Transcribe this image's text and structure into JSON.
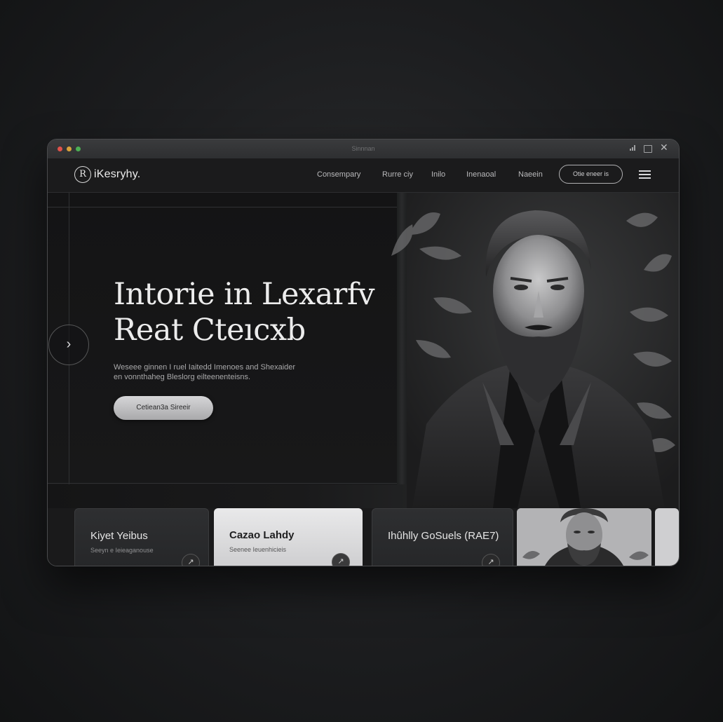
{
  "window": {
    "title": "Sinnnan"
  },
  "navbar": {
    "logo_mark": "R",
    "logo_text": "iKesryhy.",
    "links": [
      "Consempary",
      "Rurre ciy",
      "Inilo",
      "Inenaoal",
      "Naeein"
    ],
    "cta_label": "Otie eneer is"
  },
  "hero": {
    "title_line1": "Intorie in Lexarfv",
    "title_line2": "Reat Cteıcxb",
    "subtitle_line1": "Weseee ginnen I ruel Iaitedd Imenoes and Shexaider",
    "subtitle_line2": "en vonnthaheg Bleslorg eilteenenteisns.",
    "cta_label": "Cetiean3a Sireeir",
    "arrow_glyph": "›"
  },
  "cards": [
    {
      "title": "Kiyet Yeibus",
      "subtitle": "Seeyn e Ieieaganouse"
    },
    {
      "title": "Cazao Lahdy",
      "subtitle": "Seenee Ieuenhicieis"
    },
    {
      "title": "Ihûhlly GoSuels (RAE7)",
      "subtitle": ""
    }
  ],
  "colors": {
    "accent_light": "#d6d6d8",
    "background": "#1a1a1b",
    "traffic_red": "#e0524a",
    "traffic_yellow": "#d9a23b",
    "traffic_green": "#4caf54"
  },
  "icons": {
    "logo": "r-circle-logo-icon",
    "menu": "hamburger-menu-icon",
    "prev": "chevron-right-icon",
    "close": "close-icon"
  }
}
